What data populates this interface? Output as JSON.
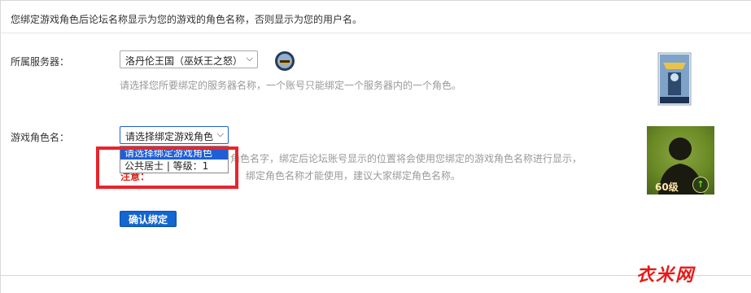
{
  "intro_text": "您绑定游戏角色后论坛名称显示为您的游戏的角色名称，否则显示为您的用户名。",
  "server": {
    "label": "所属服务器：",
    "selected": "洛丹伦王国（巫妖王之怒）",
    "hint": "请选择您所要绑定的服务器名称，一个账号只能绑定一个服务器内的一个角色。",
    "icon": "wow-server-icon"
  },
  "character": {
    "label": "游戏角色名：",
    "selected": "请选择绑定游戏角色",
    "hint_line1": "角色名字，绑定后论坛账号显示的位置将会使用您绑定的游戏角色名称进行显示，",
    "notice_label": "注意：",
    "hint_line2": "绑定角色名称才能使用，建议大家绑定角色名称。",
    "options": [
      "请选择绑定游戏角色",
      "公共居士 | 等级：1"
    ]
  },
  "avatar": {
    "level_label": "60级"
  },
  "confirm_button": "确认绑定",
  "colors": {
    "accent": "#1466d0",
    "highlight": "#e8242c",
    "hint": "#999999"
  },
  "watermark": "衣米网"
}
